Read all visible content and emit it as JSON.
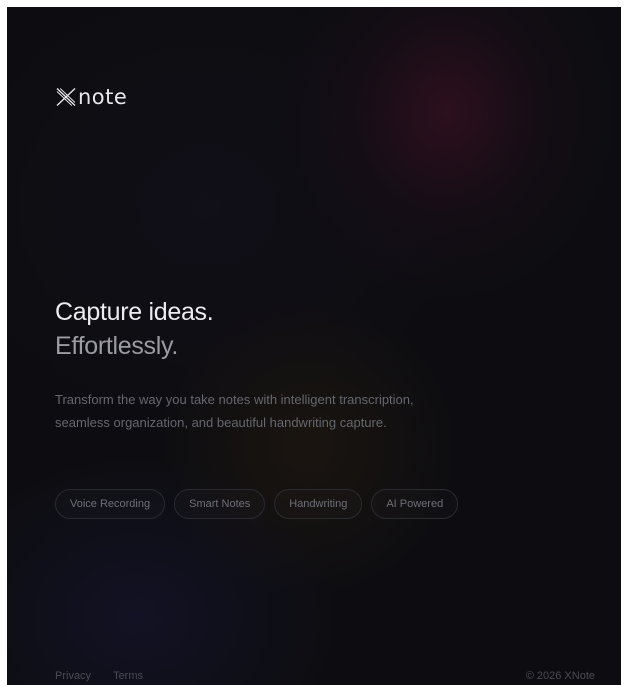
{
  "brand": {
    "logo_icon": "x-mark-icon",
    "name": "note"
  },
  "hero": {
    "headline_line1": "Capture ideas.",
    "headline_line2": "Effortlessly.",
    "description": "Transform the way you take notes with intelligent transcription, seamless organization, and beautiful handwriting capture."
  },
  "features": [
    {
      "label": "Voice Recording"
    },
    {
      "label": "Smart Notes"
    },
    {
      "label": "Handwriting"
    },
    {
      "label": "AI Powered"
    }
  ],
  "footer": {
    "privacy": "Privacy",
    "terms": "Terms",
    "copyright": "© 2026 XNote"
  },
  "colors": {
    "background": "#0d0d11",
    "headline": "#ececef",
    "headline_muted": "#9b9ba3",
    "body_text": "#66666e",
    "chip_border": "#2a2a31",
    "accent_glow": "#46122a"
  }
}
